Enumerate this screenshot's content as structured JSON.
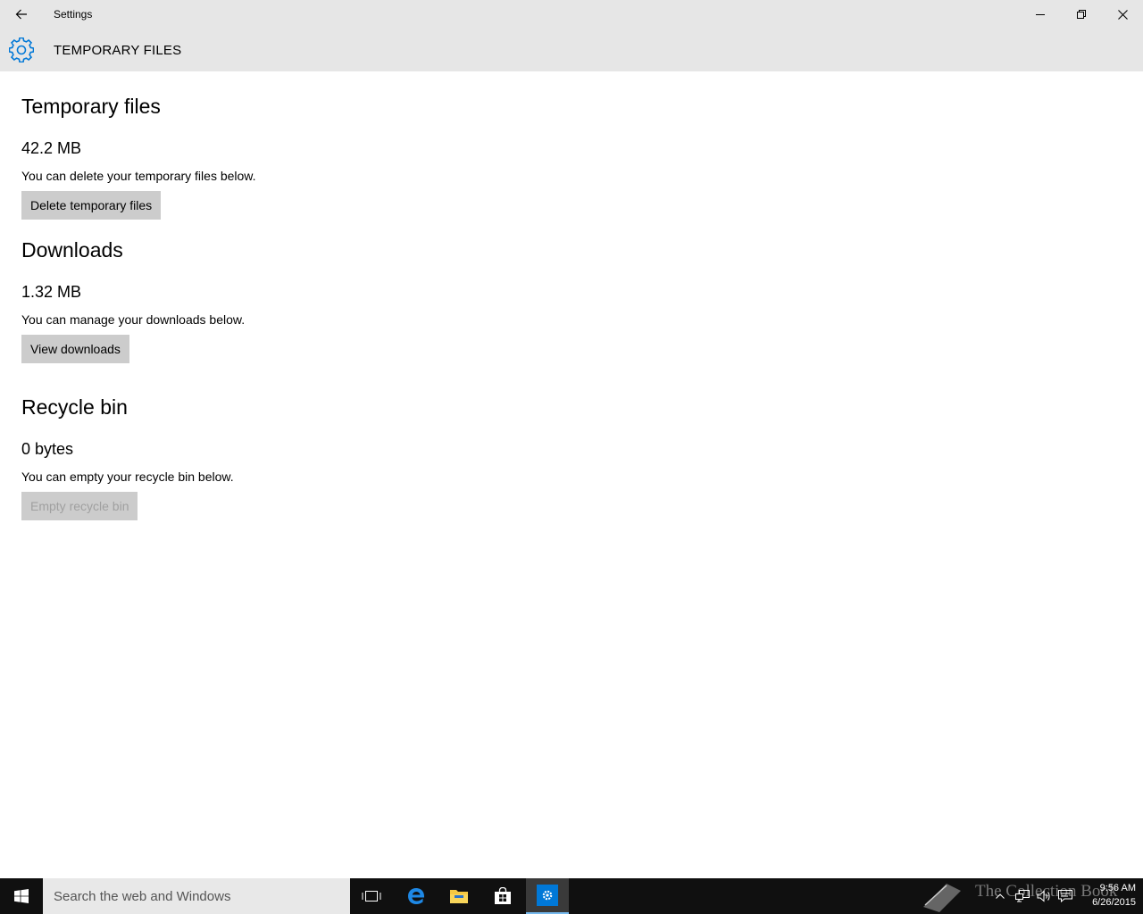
{
  "window": {
    "title": "Settings"
  },
  "header": {
    "title": "TEMPORARY FILES",
    "icon": "gear-icon",
    "accent": "#0078d7"
  },
  "sections": {
    "temp": {
      "title": "Temporary files",
      "size": "42.2 MB",
      "description": "You can delete your temporary files below.",
      "button": "Delete temporary files"
    },
    "downloads": {
      "title": "Downloads",
      "size": "1.32 MB",
      "description": "You can manage your downloads below.",
      "button": "View downloads"
    },
    "recycle": {
      "title": "Recycle bin",
      "size": "0 bytes",
      "description": "You can empty your recycle bin below.",
      "button": "Empty recycle bin",
      "button_disabled": true
    }
  },
  "taskbar": {
    "search_placeholder": "Search the web and Windows",
    "time": "9:56 AM",
    "date": "6/26/2015",
    "watermark": "The Collection Book",
    "items": [
      "task-view-icon",
      "edge-icon",
      "file-explorer-icon",
      "store-icon",
      "settings-icon"
    ]
  }
}
